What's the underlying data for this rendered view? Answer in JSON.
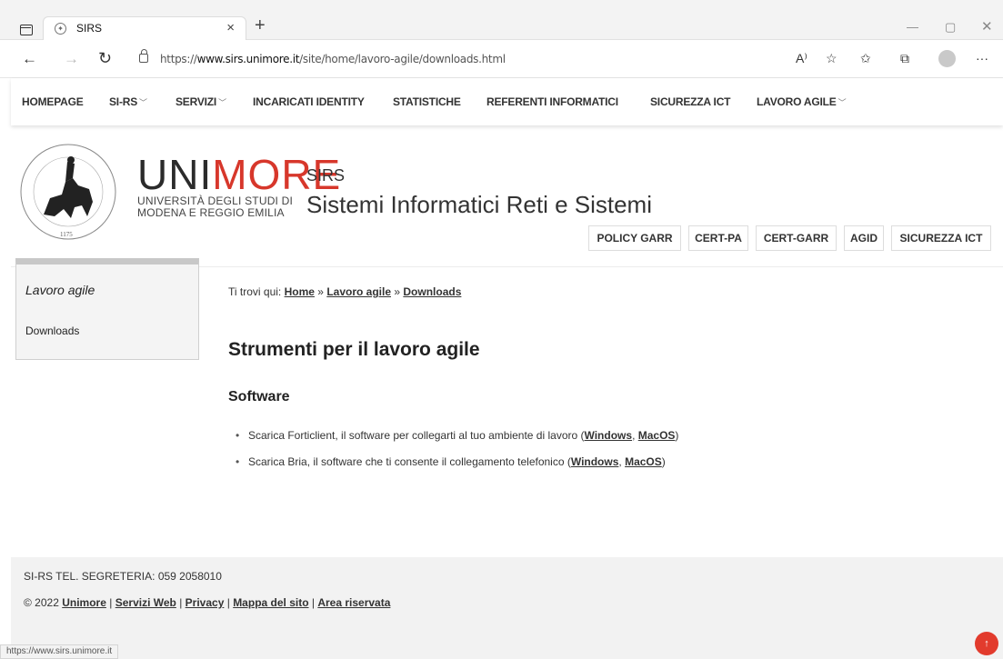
{
  "browser": {
    "tab_title": "SIRS",
    "url_prefix": "https://",
    "url_host": "www.sirs.unimore.it",
    "url_path": "/site/home/lavoro-agile/downloads.html",
    "status_url": "https://www.sirs.unimore.it"
  },
  "nav": {
    "items": [
      {
        "label": "HOMEPAGE"
      },
      {
        "label": "SI-RS"
      },
      {
        "label": "SERVIZI"
      },
      {
        "label": "INCARICATI IDENTITY"
      },
      {
        "label": "STATISTICHE"
      },
      {
        "label": "REFERENTI INFORMATICI"
      },
      {
        "label": "SICUREZZA ICT"
      },
      {
        "label": "LAVORO AGILE"
      }
    ]
  },
  "header": {
    "logo_year": "1175",
    "brand_uni": "UNI",
    "brand_more": "MORE",
    "brand_sub_line1": "UNIVERSITÀ DEGLI STUDI DI",
    "brand_sub_line2": "MODENA E REGGIO EMILIA",
    "site_short": "SIRS",
    "site_full": "Sistemi Informatici Reti e Sistemi",
    "buttons": [
      "POLICY GARR",
      "CERT-PA",
      "CERT-GARR",
      "AGID",
      "SICUREZZA ICT"
    ]
  },
  "sidebar": {
    "heading": "Lavoro agile",
    "item": "Downloads"
  },
  "breadcrumb": {
    "prefix": "Ti trovi qui:",
    "home": "Home",
    "sep": "»",
    "section": "Lavoro agile",
    "current": "Downloads"
  },
  "content": {
    "title": "Strumenti per il lavoro agile",
    "subtitle": "Software",
    "bullets": [
      {
        "text": "Scarica Forticlient, il software per collegarti al tuo ambiente di lavoro (",
        "link1": "Windows",
        "comma": ", ",
        "link2": "MacOS",
        "end": ")"
      },
      {
        "text": "Scarica Bria, il software che ti consente il collegamento telefonico (",
        "link1": "Windows",
        "comma": ", ",
        "link2": "MacOS",
        "end": ")"
      }
    ]
  },
  "footer": {
    "tel": "SI-RS TEL. SEGRETERIA: 059 2058010",
    "copyright": "© 2022",
    "links": [
      "Unimore",
      "Servizi Web",
      "Privacy",
      "Mappa del sito",
      "Area riservata"
    ],
    "sep": "|"
  },
  "colors": {
    "brand_red": "#d7372b",
    "to_top": "#e23b2d"
  }
}
